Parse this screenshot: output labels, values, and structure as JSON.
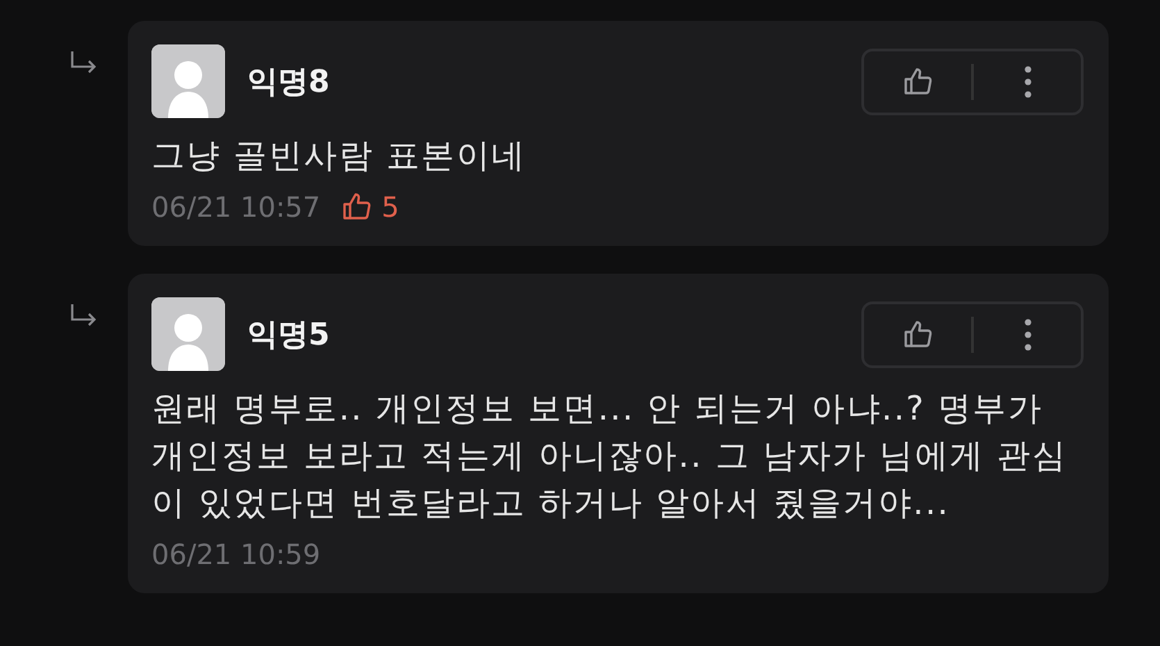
{
  "comments": [
    {
      "author": "익명8",
      "text": "그냥 골빈사람 표본이네",
      "date": "06/21 10:57",
      "likes": "5"
    },
    {
      "author": "익명5",
      "text": "원래 명부로.. 개인정보 보면... 안 되는거 아냐..? 명부가 개인정보 보라고 적는게 아니잖아.. 그 남자가 님에게 관심이 있었다면 번호달라고 하거나 알아서 줬을거야...",
      "date": "06/21 10:59"
    }
  ]
}
